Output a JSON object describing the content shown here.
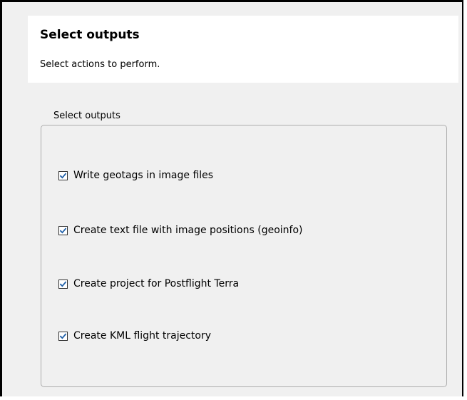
{
  "header": {
    "title": "Select outputs",
    "subtitle": "Select actions to perform."
  },
  "outputs_group": {
    "title": "Select outputs",
    "options": [
      {
        "label": "Write geotags in image files",
        "checked": true
      },
      {
        "label": "Create text file with image positions (geoinfo)",
        "checked": true
      },
      {
        "label": "Create project for Postflight Terra",
        "checked": true
      },
      {
        "label": "Create KML flight trajectory",
        "checked": true
      }
    ]
  },
  "icons": {
    "check": "checkmark-icon"
  },
  "colors": {
    "checkmark": "#1f5fa8",
    "panel_background": "#f0f0f0",
    "header_background": "#ffffff",
    "group_border": "#adadad"
  }
}
